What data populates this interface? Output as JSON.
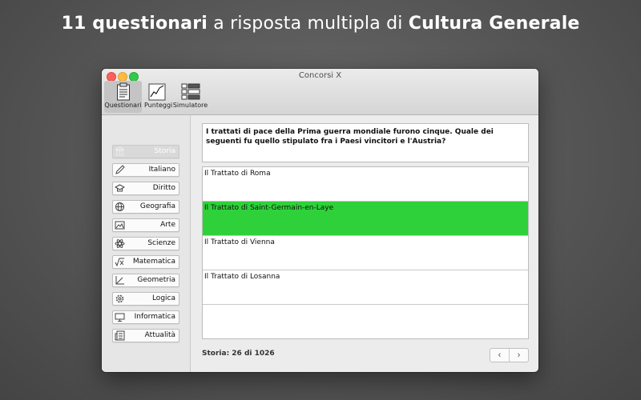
{
  "headline": {
    "part1": "11 questionari",
    "part2": " a risposta multipla di ",
    "part3": "Cultura Generale"
  },
  "window": {
    "title": "Concorsi X"
  },
  "toolbar": [
    {
      "label": "Questionari",
      "icon": "document-icon",
      "active": true
    },
    {
      "label": "Punteggi",
      "icon": "chart-icon",
      "active": false
    },
    {
      "label": "Simulatore",
      "icon": "grid-icon",
      "active": false
    }
  ],
  "categories": [
    {
      "label": "Storia",
      "icon": "building-icon",
      "selected": true
    },
    {
      "label": "Italiano",
      "icon": "pencil-icon"
    },
    {
      "label": "Diritto",
      "icon": "graduation-cap-icon"
    },
    {
      "label": "Geografia",
      "icon": "globe-icon"
    },
    {
      "label": "Arte",
      "icon": "picture-icon"
    },
    {
      "label": "Scienze",
      "icon": "atom-icon"
    },
    {
      "label": "Matematica",
      "icon": "square-root-icon"
    },
    {
      "label": "Geometria",
      "icon": "geometry-icon"
    },
    {
      "label": "Logica",
      "icon": "gear-icon"
    },
    {
      "label": "Informatica",
      "icon": "monitor-icon"
    },
    {
      "label": "Attualità",
      "icon": "newspaper-icon"
    }
  ],
  "question": "I trattati di pace della Prima guerra mondiale furono cinque. Quale dei seguenti fu quello stipulato fra i Paesi vincitori e l'Austria?",
  "answers": [
    {
      "text": "Il Trattato di Roma",
      "correct": false
    },
    {
      "text": "Il Trattato di Saint-Germain-en-Laye",
      "correct": true
    },
    {
      "text": "Il Trattato di Vienna",
      "correct": false
    },
    {
      "text": "Il Trattato di Losanna",
      "correct": false
    },
    {
      "text": "",
      "correct": false
    }
  ],
  "status": "Storia: 26 di 1026",
  "nav": {
    "prev": "‹",
    "next": "›"
  },
  "colors": {
    "correct": "#2fd13a"
  }
}
